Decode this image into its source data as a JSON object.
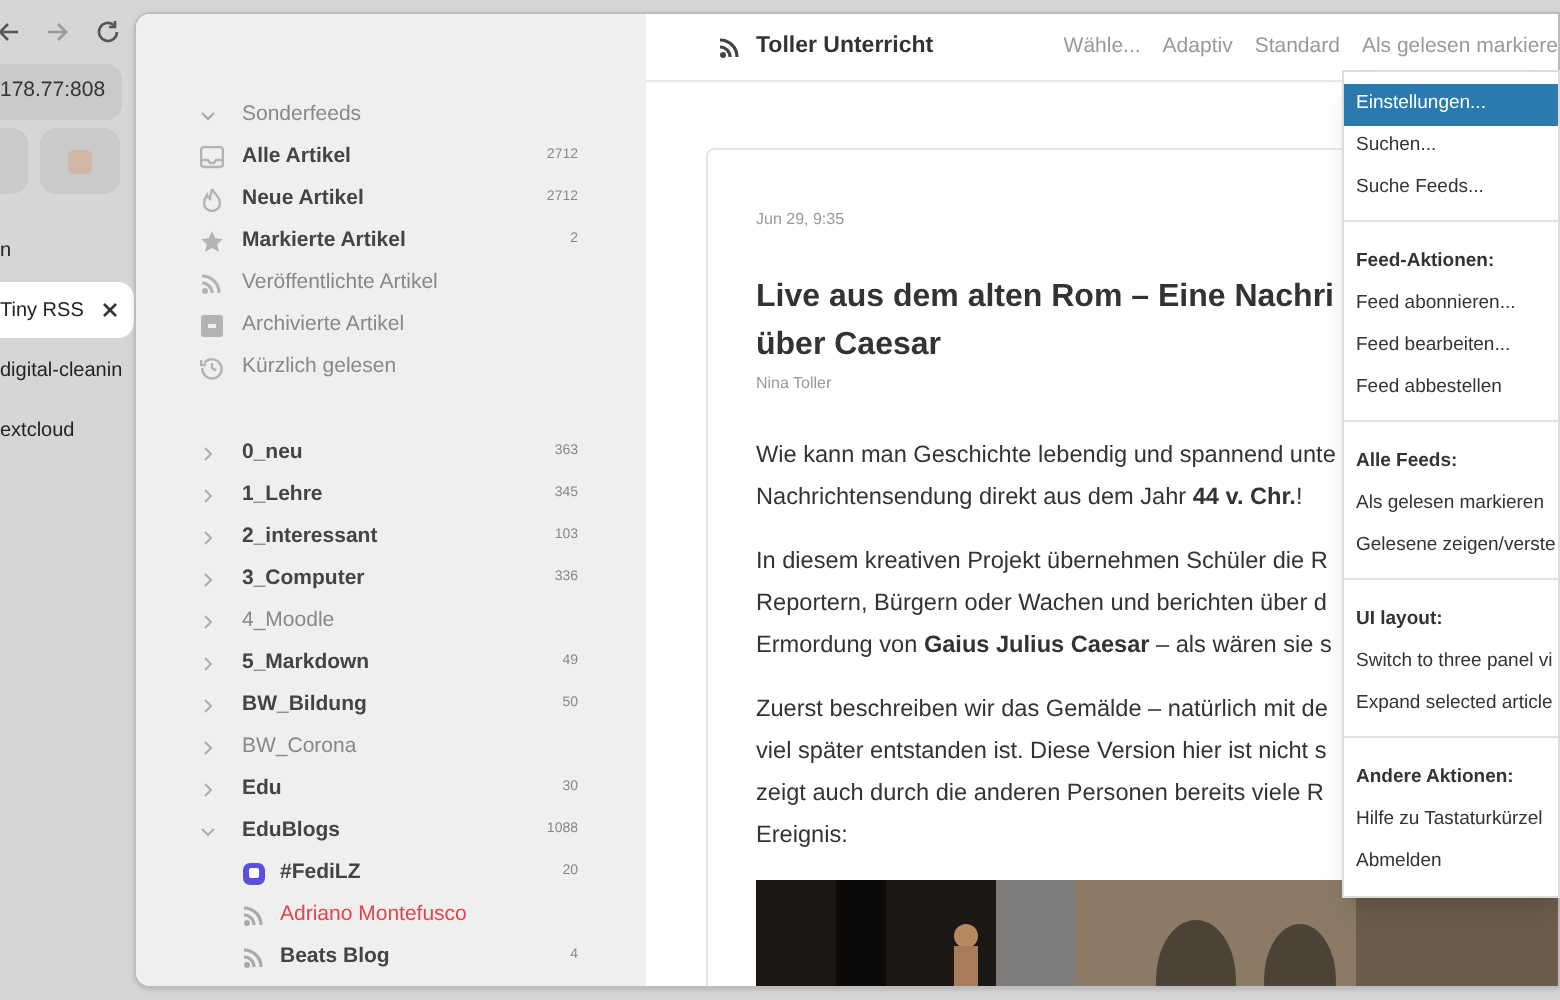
{
  "browser": {
    "address": "178.77:808",
    "tabs": [
      {
        "label": "n",
        "selected": false
      },
      {
        "label": "Tiny RSS",
        "selected": true
      },
      {
        "label": "digital-cleanin",
        "selected": false
      },
      {
        "label": "extcloud",
        "selected": false
      }
    ]
  },
  "sidebar": {
    "special": {
      "label": "Sonderfeeds",
      "expanded": true,
      "items": [
        {
          "kind": "inbox",
          "label": "Alle Artikel",
          "count": "2712"
        },
        {
          "kind": "fire",
          "label": "Neue Artikel",
          "count": "2712"
        },
        {
          "kind": "star",
          "label": "Markierte Artikel",
          "count": "2"
        },
        {
          "kind": "rss",
          "label": "Veröffentlichte Artikel"
        },
        {
          "kind": "archive",
          "label": "Archivierte Artikel"
        },
        {
          "kind": "history",
          "label": "Kürzlich gelesen"
        }
      ]
    },
    "categories": [
      {
        "label": "0_neu",
        "count": "363",
        "expanded": false
      },
      {
        "label": "1_Lehre",
        "count": "345",
        "expanded": false
      },
      {
        "label": "2_interessant",
        "count": "103",
        "expanded": false
      },
      {
        "label": "3_Computer",
        "count": "336",
        "expanded": false
      },
      {
        "label": "4_Moodle",
        "expanded": false
      },
      {
        "label": "5_Markdown",
        "count": "49",
        "expanded": false
      },
      {
        "label": "BW_Bildung",
        "count": "50",
        "expanded": false
      },
      {
        "label": "BW_Corona",
        "expanded": false
      },
      {
        "label": "Edu",
        "count": "30",
        "expanded": false
      },
      {
        "label": "EduBlogs",
        "count": "1088",
        "expanded": true,
        "children": [
          {
            "kind": "mastodon",
            "label": "#FediLZ",
            "count": "20",
            "error": false
          },
          {
            "kind": "rss",
            "label": "Adriano Montefusco",
            "error": true
          },
          {
            "kind": "rss",
            "label": "Beats Blog",
            "count": "4",
            "error": false
          }
        ]
      }
    ]
  },
  "header": {
    "title": "Toller Unterricht",
    "options": [
      "Wähle...",
      "Adaptiv",
      "Standard",
      "Als gelesen markiere"
    ]
  },
  "article": {
    "date": "Jun 29, 9:35",
    "title": "Live aus dem alten Rom – Eine Nachri\nüber Caesar",
    "author": "Nina Toller",
    "paragraphs": [
      "Wie kann man Geschichte lebendig und spannend unte\nNachrichtensendung direkt aus dem Jahr **44 v. Chr.**!",
      "In diesem kreativen Projekt übernehmen Schüler die R\nReportern, Bürgern oder Wachen und berichten über d\nErmordung von **Gaius Julius Caesar** – als wären sie s",
      "Zuerst beschreiben wir das Gemälde – natürlich mit de\nviel später entstanden ist. Diese Version hier ist nicht s\nzeigt auch durch die anderen Personen bereits viele R\nEreignis:"
    ],
    "image": {
      "kind": "picture"
    }
  },
  "menu": {
    "sections": [
      {
        "items": [
          {
            "label": "Einstellungen...",
            "selected": true
          },
          {
            "label": "Suchen...",
            "selected": false
          },
          {
            "label": "Suche Feeds...",
            "selected": false
          }
        ]
      },
      {
        "heading": "Feed-Aktionen:",
        "items": [
          {
            "label": "Feed abonnieren...",
            "selected": false
          },
          {
            "label": "Feed bearbeiten...",
            "selected": false
          },
          {
            "label": "Feed abbestellen",
            "selected": false
          }
        ]
      },
      {
        "heading": "Alle Feeds:",
        "items": [
          {
            "label": "Als gelesen markieren",
            "selected": false
          },
          {
            "label": "Gelesene zeigen/verste",
            "selected": false
          }
        ]
      },
      {
        "heading": "UI layout:",
        "items": [
          {
            "label": "Switch to three panel vi",
            "selected": false
          },
          {
            "label": "Expand selected article",
            "selected": false
          }
        ]
      },
      {
        "heading": "Andere Aktionen:",
        "items": [
          {
            "label": "Hilfe zu Tastaturkürzel",
            "selected": false
          },
          {
            "label": "Abmelden",
            "selected": false
          }
        ]
      }
    ]
  }
}
